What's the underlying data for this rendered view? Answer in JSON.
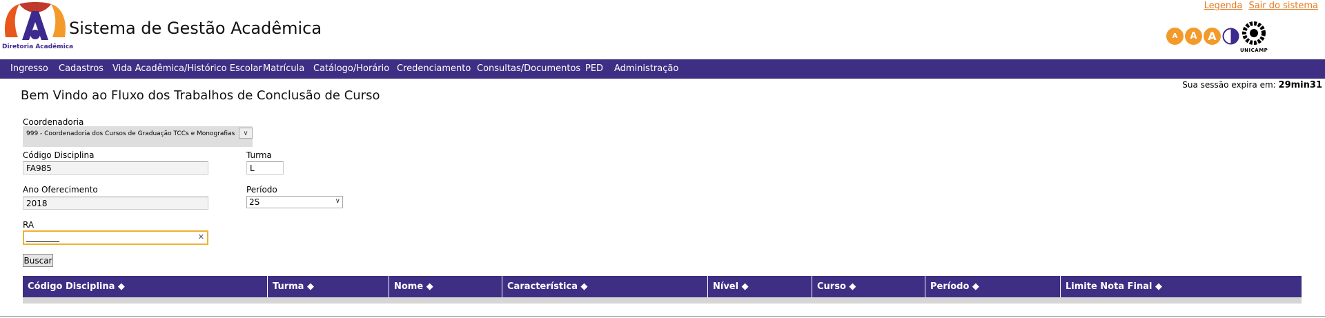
{
  "header": {
    "title": "Sistema de Gestão Acadêmica",
    "logo_caption": "Diretoria Acadêmica",
    "links": {
      "legenda": "Legenda",
      "sair": "Sair do sistema"
    },
    "accessibility": {
      "a_small": "A",
      "a_medium": "A",
      "a_large": "A"
    },
    "unicamp_caption": "UNICAMP"
  },
  "menu": {
    "items": [
      "Ingresso",
      "Cadastros",
      "Vida Acadêmica/Histórico Escolar",
      "Matrícula",
      "Catálogo/Horário",
      "Credenciamento",
      "Consultas/Documentos",
      "PED",
      "Administração"
    ]
  },
  "session": {
    "label": "Sua sessão expira em:",
    "time": "29min31"
  },
  "page": {
    "title": "Bem Vindo ao Fluxo dos Trabalhos de Conclusão de Curso"
  },
  "form": {
    "coordenadoria": {
      "label": "Coordenadoria",
      "value": "999 - Coordenadoria dos Cursos de Graduação TCCs e Monografias"
    },
    "codigo_disciplina": {
      "label": "Código Disciplina",
      "value": "FA985"
    },
    "turma": {
      "label": "Turma",
      "value": "L"
    },
    "ano_oferecimento": {
      "label": "Ano Oferecimento",
      "value": "2018"
    },
    "periodo": {
      "label": "Período",
      "value": "2S"
    },
    "ra": {
      "label": "RA",
      "value": "________"
    },
    "buscar_label": "Buscar"
  },
  "table": {
    "columns": [
      "Código Disciplina",
      "Turma",
      "Nome",
      "Característica",
      "Nível",
      "Curso",
      "Período",
      "Limite Nota Final"
    ],
    "sort_glyph": "◆"
  },
  "colors": {
    "primary": "#3e2f84",
    "accent": "#e8771b"
  }
}
